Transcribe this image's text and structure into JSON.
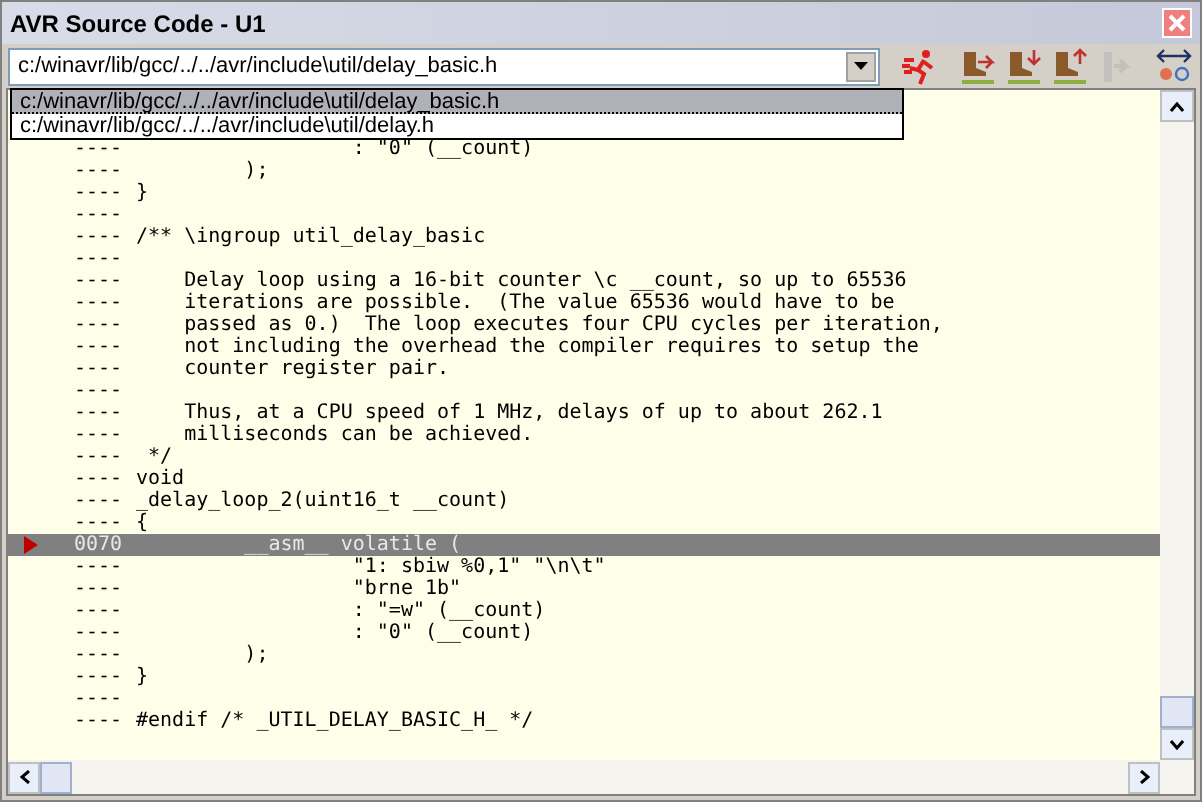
{
  "window": {
    "title": "AVR Source Code - U1"
  },
  "file_combo": {
    "value": "c:/winavr/lib/gcc/../../avr/include\\util/delay_basic.h",
    "expanded": true,
    "options": [
      {
        "label": "c:/winavr/lib/gcc/../../avr/include\\util/delay_basic.h",
        "selected": true
      },
      {
        "label": "c:/winavr/lib/gcc/../../avr/include\\util/delay.h",
        "selected": false
      }
    ]
  },
  "toolbar": [
    {
      "kind": "run",
      "disabled": false
    },
    {
      "kind": "step-over",
      "disabled": false
    },
    {
      "kind": "step-into",
      "disabled": false
    },
    {
      "kind": "step-out",
      "disabled": false
    },
    {
      "kind": "run-to",
      "disabled": true
    },
    {
      "kind": "link",
      "disabled": false
    }
  ],
  "lines": [
    {
      "number": "----",
      "text": "                  : \"0\" (__count)",
      "current": false
    },
    {
      "number": "----",
      "text": "         );",
      "current": false
    },
    {
      "number": "----",
      "text": "}",
      "current": false
    },
    {
      "number": "----",
      "current": false
    },
    {
      "number": "----",
      "text": "/** \\ingroup util_delay_basic",
      "current": false
    },
    {
      "number": "----",
      "current": false
    },
    {
      "number": "----",
      "text": "    Delay loop using a 16-bit counter \\c __count, so up to 65536",
      "current": false
    },
    {
      "number": "----",
      "text": "    iterations are possible.  (The value 65536 would have to be",
      "current": false
    },
    {
      "number": "----",
      "text": "    passed as 0.)  The loop executes four CPU cycles per iteration,",
      "current": false
    },
    {
      "number": "----",
      "text": "    not including the overhead the compiler requires to setup the",
      "current": false
    },
    {
      "number": "----",
      "text": "    counter register pair.",
      "current": false
    },
    {
      "number": "----",
      "current": false
    },
    {
      "number": "----",
      "text": "    Thus, at a CPU speed of 1 MHz, delays of up to about 262.1",
      "current": false
    },
    {
      "number": "----",
      "text": "    milliseconds can be achieved.",
      "current": false
    },
    {
      "number": "----",
      "text": " */",
      "current": false
    },
    {
      "number": "----",
      "text": "void",
      "current": false
    },
    {
      "number": "----",
      "text": "_delay_loop_2(uint16_t __count)",
      "current": false
    },
    {
      "number": "----",
      "text": "{",
      "current": false
    },
    {
      "number": "0070",
      "text": "         __asm__ volatile (",
      "current": true
    },
    {
      "number": "----",
      "text": "                  \"1: sbiw %0,1\" \"\\n\\t\"",
      "current": false
    },
    {
      "number": "----",
      "text": "                  \"brne 1b\"",
      "current": false
    },
    {
      "number": "----",
      "text": "                  : \"=w\" (__count)",
      "current": false
    },
    {
      "number": "----",
      "text": "                  : \"0\" (__count)",
      "current": false
    },
    {
      "number": "----",
      "text": "         );",
      "current": false
    },
    {
      "number": "----",
      "text": "}",
      "current": false
    },
    {
      "number": "----",
      "current": false
    },
    {
      "number": "----",
      "text": "#endif /* _UTIL_DELAY_BASIC_H_ */",
      "current": false
    }
  ]
}
